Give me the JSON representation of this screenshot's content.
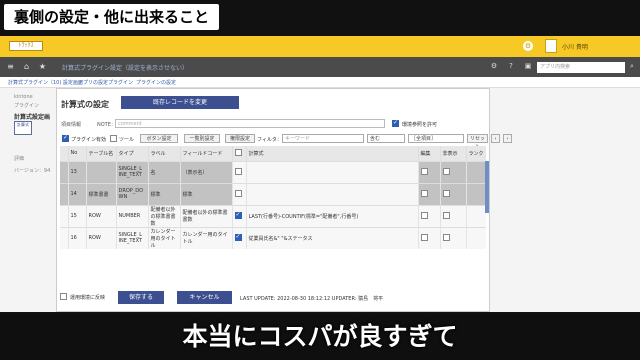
{
  "overlay": {
    "top_caption": "裏側の設定・他に出来ること",
    "bottom_caption": "本当にコスパが良すぎて"
  },
  "app": {
    "logo_text": "ﾄﾗｯｸｽ",
    "user_name": "小川 貴明",
    "search_placeholder": "アプリ内検索",
    "nav_title": "計算式プラグイン設定（設定を表示させない）"
  },
  "breadcrumbs": [
    "計算式プラグイン（10) 設定画面",
    "アプリの設定",
    "プラグイン",
    "プラグインの設定"
  ],
  "sidebar": {
    "items": [
      "kintone",
      "プラグイン",
      "計算式設定画",
      "評価",
      "バージョン：94"
    ],
    "icon_label": "計算式"
  },
  "form": {
    "title": "計算式の設定",
    "reuse_button": "既存レコードを変更",
    "item_info_label": "項目情報",
    "note_label": "NOTE：",
    "note_value": "comment",
    "env_checkbox_label": "環境参照を許可",
    "plugin_enable_label": "プラグイン有効",
    "tool_label": "ツール",
    "button_setting": "ボタン設定",
    "bulk_setting": "一覧別設定",
    "auth_setting": "権限設定",
    "filter_label": "フィルタ：",
    "keyword_placeholder": "キーワード",
    "contains_option": "含む",
    "all_items_option": "［全項目］",
    "reset_button": "リセット",
    "nav_prev": "‹",
    "nav_next": "›"
  },
  "table": {
    "headers": [
      "",
      "No",
      "テーブル名",
      "タイプ",
      "ラベル",
      "フィールドコード",
      "",
      "計算式",
      "編集",
      "非表示",
      "ランク"
    ],
    "rows": [
      {
        "no": "13",
        "table": "",
        "type": "SINGLE_L INE_TEXT",
        "label": "名",
        "code": "（表示名）",
        "checked": false,
        "formula": ""
      },
      {
        "no": "14",
        "table": "標準書書",
        "type": "DROP_DO WN",
        "label": "標準",
        "code": "標準",
        "checked": false,
        "formula": ""
      },
      {
        "no": "15",
        "table": "ROW",
        "type": "NUMBER",
        "label": "配備者以外の標準書書数",
        "code": "配備者以外の標準書書数",
        "checked": true,
        "formula": "LAST(行番号)-COUNTIF(標準=\"配備者\",行番号)"
      },
      {
        "no": "16",
        "table": "ROW",
        "type": "SINGLE_L INE_TEXT",
        "label": "カレンダー用のタイトル",
        "code": "カレンダー用のタイトル",
        "checked": true,
        "formula": "従業員氏名&\" \"&ステータス"
      }
    ]
  },
  "footer": {
    "apply_label": "運用環境に反映",
    "save_button": "保存する",
    "cancel_button": "キャンセル",
    "update_text": "LAST UPDATE: 2022-08-30 18:12:12 UPDATER: 猿島　将平"
  }
}
